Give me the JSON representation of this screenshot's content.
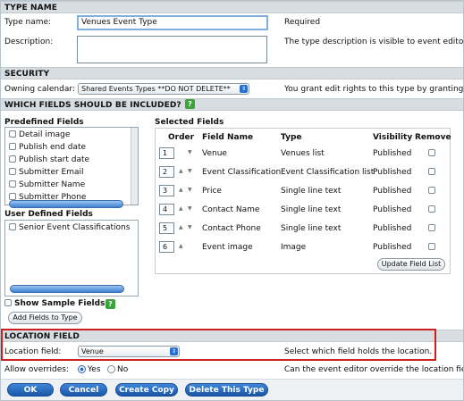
{
  "type_name": {
    "header": "TYPE NAME",
    "name_label": "Type name:",
    "name_value": "Venues Event Type",
    "required": "Required",
    "description_label": "Description:",
    "description_value": "",
    "description_hint": "The type description is visible to event editors."
  },
  "security": {
    "header": "SECURITY",
    "calendar_label": "Owning calendar:",
    "calendar_value": "Shared Events Types **DO NOT DELETE**",
    "hint": "You grant edit rights to this type by granting ed"
  },
  "fields": {
    "header": "WHICH FIELDS SHOULD BE INCLUDED?",
    "predefined_label": "Predefined Fields",
    "predefined_items": [
      "Detail image",
      "Publish end date",
      "Publish start date",
      "Submitter Email",
      "Submitter Name",
      "Submitter Phone"
    ],
    "user_defined_label": "User Defined Fields",
    "user_defined_items": [
      "Senior Event Classifications"
    ],
    "show_sample_label": "Show Sample Fields",
    "add_button": "Add Fields to Type",
    "selected_label": "Selected Fields",
    "columns": [
      "Order",
      "Field Name",
      "Type",
      "Visibility",
      "Remove"
    ],
    "rows": [
      {
        "order": "1",
        "name": "Venue",
        "type": "Venues list",
        "visibility": "Published"
      },
      {
        "order": "2",
        "name": "Event Classification",
        "type": "Event Classification list",
        "visibility": "Published"
      },
      {
        "order": "3",
        "name": "Price",
        "type": "Single line text",
        "visibility": "Published"
      },
      {
        "order": "4",
        "name": "Contact Name",
        "type": "Single line text",
        "visibility": "Published"
      },
      {
        "order": "5",
        "name": "Contact Phone",
        "type": "Single line text",
        "visibility": "Published"
      },
      {
        "order": "6",
        "name": "Event image",
        "type": "Image",
        "visibility": "Published"
      }
    ],
    "update_button": "Update Field List"
  },
  "location": {
    "header": "LOCATION FIELD",
    "label": "Location field:",
    "value": "Venue",
    "hint": "Select which field holds the location.",
    "overrides_label": "Allow overrides:",
    "yes": "Yes",
    "no": "No",
    "overrides_hint": "Can the event editor override the location field"
  },
  "actions": {
    "ok": "OK",
    "cancel": "Cancel",
    "copy": "Create Copy",
    "delete": "Delete This Type"
  }
}
